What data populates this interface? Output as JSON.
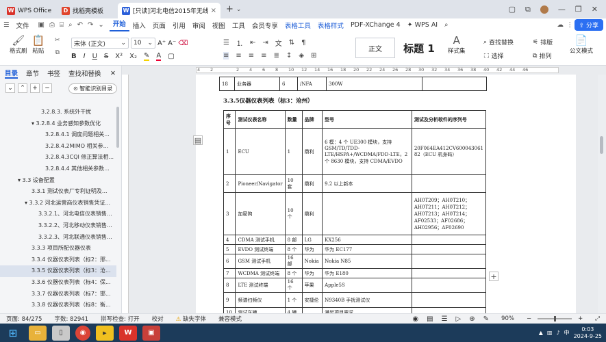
{
  "tabs": [
    {
      "label": "WPS Office",
      "icon": "wps-icon",
      "color": "#d9332b"
    },
    {
      "label": "找稻壳模板",
      "icon": "docer-icon",
      "color": "#e0452d"
    },
    {
      "label": "[只读]河北电信2015年无线网",
      "icon": "word-icon",
      "color": "#2b5fd9"
    }
  ],
  "menu": {
    "file": "文件",
    "items": [
      "开始",
      "插入",
      "页面",
      "引用",
      "审阅",
      "视图",
      "工具",
      "会员专享"
    ],
    "contextual": [
      "表格工具",
      "表格样式"
    ],
    "extra": [
      "PDF-XChange 4",
      "WPS AI"
    ],
    "share": "分享"
  },
  "ribbon": {
    "format_painter": "格式刷",
    "paste": "粘贴",
    "font_name": "宋体 (正文)",
    "font_size": "10",
    "style_normal": "正文",
    "style_heading": "标题 1",
    "styles_label": "样式集",
    "find_replace": "查找替换",
    "select": "选择",
    "sort": "排版",
    "arrange": "排列",
    "doc_format": "公文模式"
  },
  "leftpane": {
    "tabs": [
      "目录",
      "章节",
      "书签",
      "查找和替换"
    ],
    "smart_toc": "智能识别目录",
    "toc": [
      {
        "text": "3.2.8.3. 系统外干扰",
        "indent": 60
      },
      {
        "text": "▾ 3.2.8.4 业务感知参数优化",
        "indent": 46
      },
      {
        "text": "3.2.8.4.1 调度问题相关...",
        "indent": 66
      },
      {
        "text": "3.2.8.4.2MIMO 相关参...",
        "indent": 66
      },
      {
        "text": "3.2.8.4.3CQI 修正算法相...",
        "indent": 66
      },
      {
        "text": "3.2.8.4.4 其他相关参数...",
        "indent": 66
      },
      {
        "text": "▾ 3.3 设备配置",
        "indent": 26
      },
      {
        "text": "3.3.1 测试仪表厂专利证明及...",
        "indent": 46
      },
      {
        "text": "▾ 3.3.2 河北运营商仪表销售凭证...",
        "indent": 36
      },
      {
        "text": "3.3.2.1、河北电信仪表销售...",
        "indent": 56
      },
      {
        "text": "3.3.2.2、河北移动仪表销售...",
        "indent": 56
      },
      {
        "text": "3.3.2.3、河北联通仪表销售...",
        "indent": 56
      },
      {
        "text": "3.3.3 项目所配仪器仪表",
        "indent": 46
      },
      {
        "text": "3.3.4 仪器仪表列表（标2：邢...",
        "indent": 46
      },
      {
        "text": "3.3.5 仪器仪表列表（标3：沧...",
        "indent": 46,
        "selected": true
      },
      {
        "text": "3.3.6 仪器仪表列表（标4：保...",
        "indent": 46
      },
      {
        "text": "3.3.7 仪器仪表列表（标7：邯...",
        "indent": 46
      },
      {
        "text": "3.3.8 仪器仪表列表（标8：衡...",
        "indent": 46
      }
    ]
  },
  "document": {
    "top_row": [
      "18",
      "业务器",
      "6",
      "/NFA",
      "300W"
    ],
    "heading": "3.3.5仪器仪表列表（标3：沧州）",
    "headers": [
      "序号",
      "测试仪表名称",
      "数量",
      "品牌",
      "型号",
      "测试及分析软件的序列号"
    ],
    "rows": [
      [
        "1",
        "ECU",
        "1",
        "鼎利",
        "6 模：4 个 UE300 模块，支持 GSM/TD/TDD-LTE/HSPA+/WCDMA/FDD-LTE，2 个 8630 模块，支持 CDMA/EVDO",
        "20F064EA412CV600043061 82（ECU 机身码）"
      ],
      [
        "2",
        "Pioneer/Navigator",
        "10 套",
        "鼎利",
        "9.2 以上新本",
        ""
      ],
      [
        "3",
        "加密狗",
        "10 个",
        "鼎利",
        "",
        "AH0T209；AH0T210；AH0T211；AH0T212；AH0T213；AH0T214；AF02533；AF02686；AH02956；AF02690"
      ],
      [
        "4",
        "CDMA 测试手机",
        "8 部",
        "LG",
        "KX256",
        ""
      ],
      [
        "5",
        "EVDO 测试终端",
        "8 个",
        "华为",
        "华为 EC177",
        ""
      ],
      [
        "6",
        "GSM 测试手机",
        "16 部",
        "Nokia",
        "Nokia N85",
        ""
      ],
      [
        "7",
        "WCDMA 测试终端",
        "8 个",
        "华为",
        "华为 E180",
        ""
      ],
      [
        "8",
        "LTE 测试终端",
        "16 个",
        "苹果",
        "Apple5S",
        ""
      ],
      [
        "9",
        "频谱扫频仪",
        "1 个",
        "安捷伦",
        "N9340B 手扰测试仪",
        ""
      ],
      [
        "10",
        "测试车辆",
        "4 辆",
        "",
        "满足项目需求",
        ""
      ]
    ]
  },
  "status": {
    "page": "页面: 84/275",
    "words": "字数: 82941",
    "spell": "拼写检查: 打开",
    "proof": "校对",
    "missing_font": "缺失字体",
    "compat": "兼容模式",
    "zoom": "90%"
  },
  "taskbar": {
    "time": "0:03",
    "date": "2024-9-25"
  }
}
